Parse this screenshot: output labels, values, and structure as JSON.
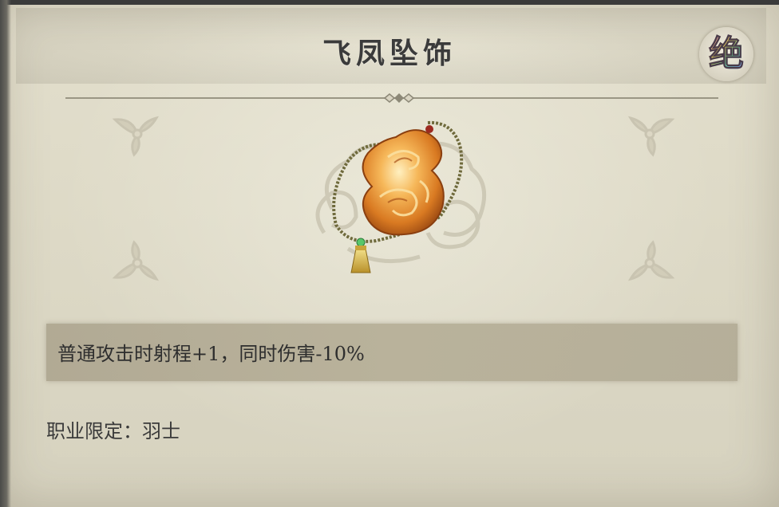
{
  "item": {
    "name": "飞凤坠饰",
    "rarity": "绝",
    "description": "普通攻击时射程+1，同时伤害-10%",
    "class_restriction": "职业限定：羽士",
    "icon": "amber-phoenix-pendant-icon"
  },
  "colors": {
    "panel_bg": "#e0dccb",
    "desc_bar": "#b9b29b",
    "text": "#2e2e2e",
    "amber": "#e08a2a"
  }
}
